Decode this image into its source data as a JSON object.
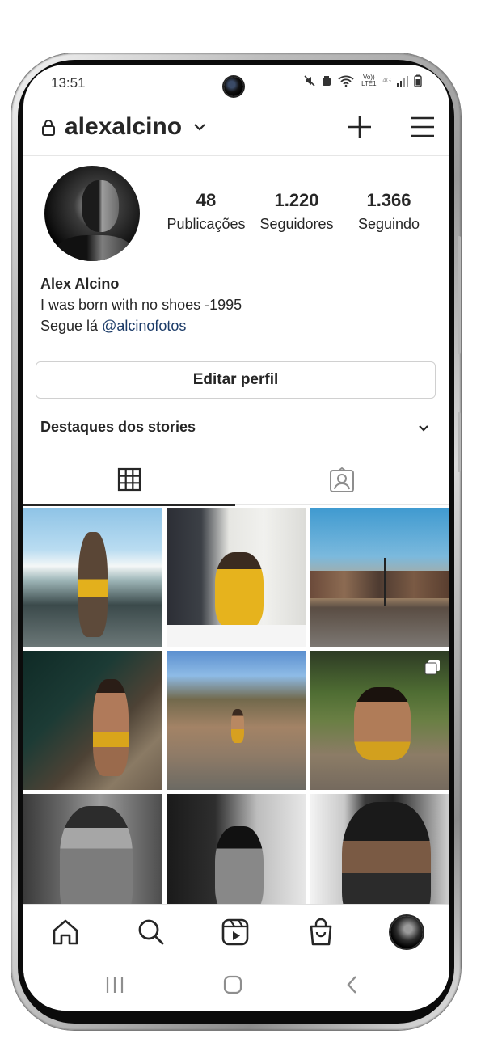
{
  "status_bar": {
    "time": "13:51",
    "network_label": "Vo)) LTE1",
    "network_type": "4G"
  },
  "header": {
    "username": "alexalcino"
  },
  "profile": {
    "stats": [
      {
        "value": "48",
        "label": "Publicações"
      },
      {
        "value": "1.220",
        "label": "Seguidores"
      },
      {
        "value": "1.366",
        "label": "Seguindo"
      }
    ],
    "name": "Alex Alcino",
    "bio_line": "I was born with no shoes -1995",
    "bio_prefix": "Segue lá ",
    "bio_link": "@alcinofotos",
    "edit_button": "Editar perfil",
    "highlights_label": "Destaques dos stories"
  },
  "tabs": [
    {
      "name": "grid",
      "icon": "grid-icon",
      "active": true
    },
    {
      "name": "tagged",
      "icon": "tagged-person-icon",
      "active": false
    }
  ],
  "posts": [
    {
      "icon": "photo",
      "multi": false
    },
    {
      "icon": "photo",
      "multi": false
    },
    {
      "icon": "photo",
      "multi": false
    },
    {
      "icon": "photo",
      "multi": false
    },
    {
      "icon": "photo",
      "multi": false
    },
    {
      "icon": "photo",
      "multi": true
    },
    {
      "icon": "photo",
      "multi": false
    },
    {
      "icon": "photo",
      "multi": false
    },
    {
      "icon": "photo",
      "multi": false
    }
  ],
  "bottom_nav": [
    "home-icon",
    "search-icon",
    "reels-icon",
    "shop-icon",
    "profile-avatar"
  ],
  "system_nav": [
    "recent-apps-icon",
    "home-button-icon",
    "back-icon"
  ],
  "colors": {
    "text": "#262626",
    "link": "#1a3a67",
    "divider": "#e6e6e6"
  }
}
